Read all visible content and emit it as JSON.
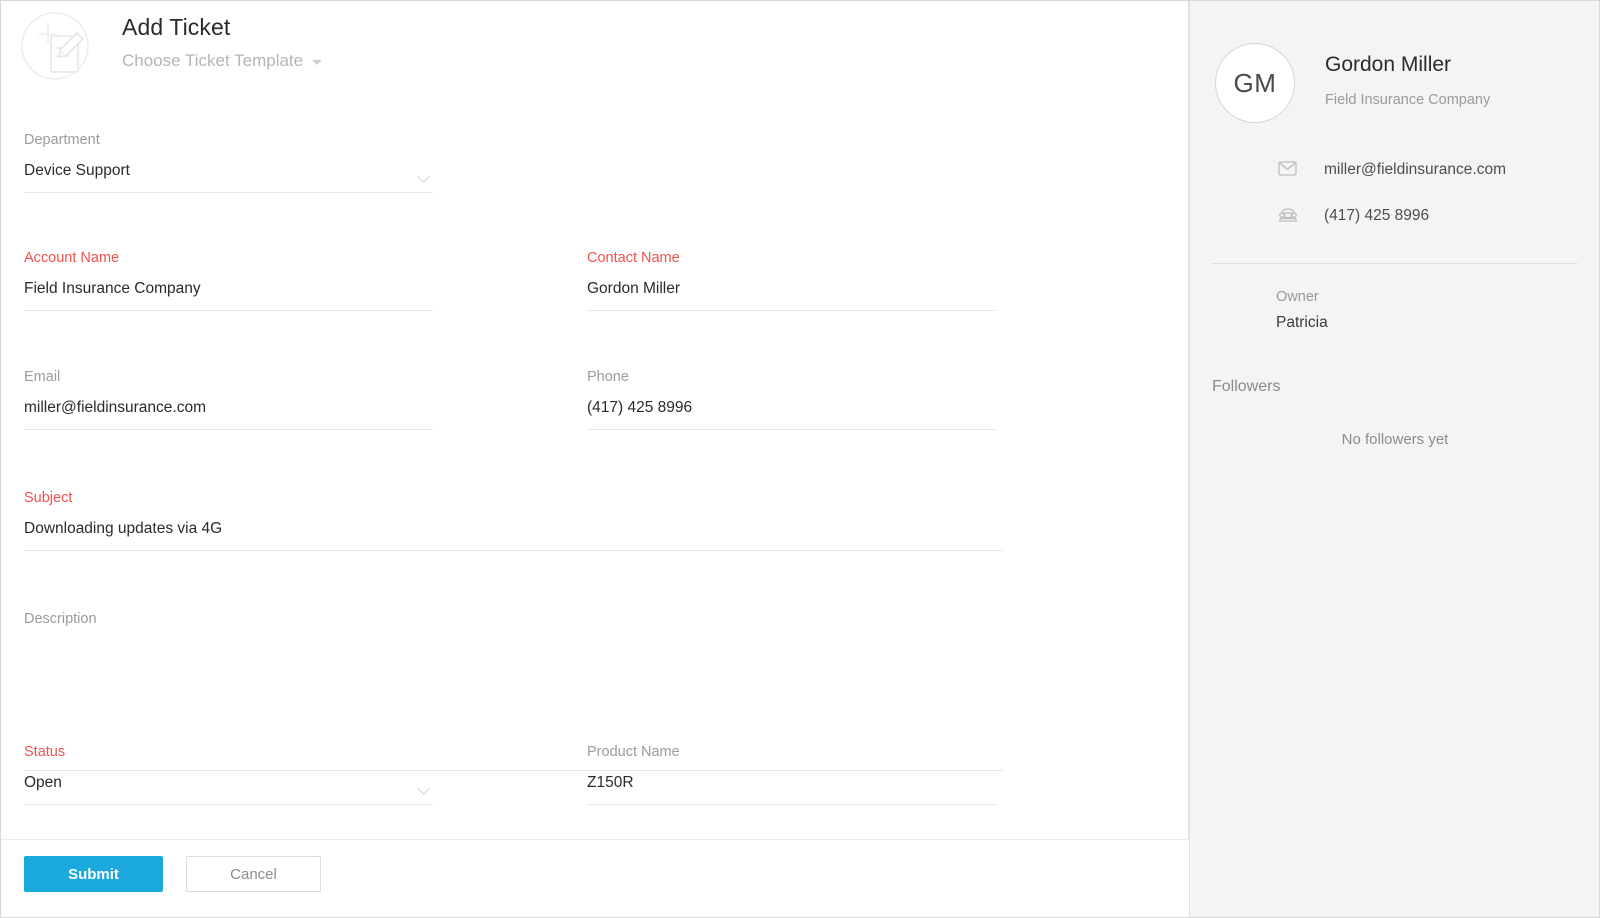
{
  "header": {
    "title": "Add Ticket",
    "template_label": "Choose Ticket Template",
    "icon": "add-ticket-icon",
    "dropdown_icon": "caret-down-icon"
  },
  "form": {
    "fields": [
      {
        "key": "department",
        "label": "Department",
        "required": false,
        "value": "Device Support",
        "type": "select"
      },
      {
        "key": "account",
        "label": "Account Name",
        "required": true,
        "value": "Field Insurance Company",
        "type": "text"
      },
      {
        "key": "contact",
        "label": "Contact Name",
        "required": true,
        "value": "Gordon Miller",
        "type": "text"
      },
      {
        "key": "email",
        "label": "Email",
        "required": false,
        "value": "miller@fieldinsurance.com",
        "type": "text"
      },
      {
        "key": "phone",
        "label": "Phone",
        "required": false,
        "value": "(417) 425 8996",
        "type": "text"
      },
      {
        "key": "subject",
        "label": "Subject",
        "required": true,
        "value": "Downloading updates via 4G",
        "type": "text"
      },
      {
        "key": "description",
        "label": "Description",
        "required": false,
        "value": "",
        "type": "textarea"
      },
      {
        "key": "status",
        "label": "Status",
        "required": true,
        "value": "Open",
        "type": "select"
      },
      {
        "key": "product",
        "label": "Product Name",
        "required": false,
        "value": "Z150R",
        "type": "text"
      }
    ]
  },
  "footer": {
    "submit_label": "Submit",
    "cancel_label": "Cancel"
  },
  "sidebar": {
    "avatar_initials": "GM",
    "contact_name": "Gordon Miller",
    "organization": "Field Insurance Company",
    "email": "miller@fieldinsurance.com",
    "phone": "(417) 425 8996",
    "email_icon": "envelope-icon",
    "phone_icon": "telephone-icon",
    "owner_label": "Owner",
    "owner_value": "Patricia",
    "followers_label": "Followers",
    "followers_empty": "No followers yet"
  },
  "colors": {
    "required_red": "#f4514e",
    "submit_blue": "#1ba8dd",
    "sidebar_bg": "#f4f4f4",
    "label_gray": "#9b9b9b",
    "underline": "#e6e6e6"
  }
}
